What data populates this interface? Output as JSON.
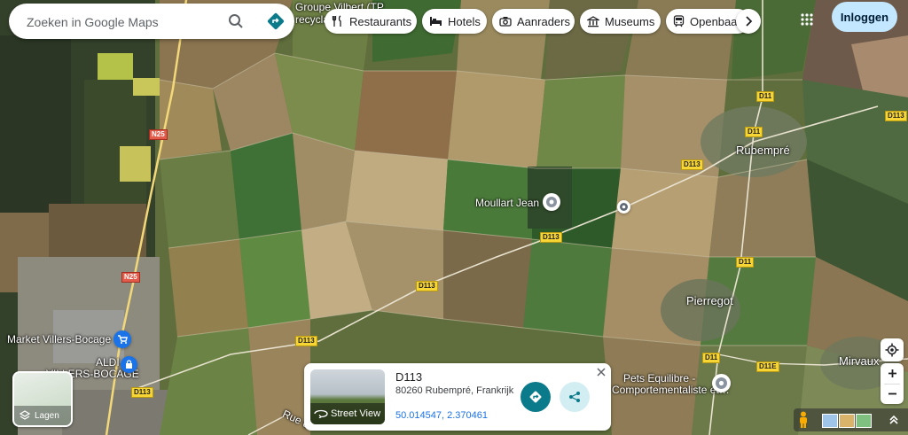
{
  "search": {
    "placeholder": "Zoeken in Google Maps"
  },
  "categories": [
    {
      "label": "Restaurants",
      "icon": "fork-knife-icon"
    },
    {
      "label": "Hotels",
      "icon": "bed-icon"
    },
    {
      "label": "Aanraders",
      "icon": "camera-icon"
    },
    {
      "label": "Museums",
      "icon": "museum-icon"
    },
    {
      "label": "Openbaar",
      "icon": "transit-icon"
    }
  ],
  "header": {
    "signin_label": "Inloggen"
  },
  "places": {
    "groupe": "Groupe Vilbert (TP",
    "recycla": "recycla",
    "rubempre": "Rubempré",
    "moullart": "Moullart Jean",
    "pierregot": "Pierregot",
    "mirvaux": "Mirvaux",
    "market": "Market Villers-Bocage",
    "aldi": "ALDI",
    "villers": "VILLERS-BOCAGE",
    "pets1": "Pets Equilibre -",
    "pets2": "Comportementaliste et…",
    "rue": "Rue d"
  },
  "roads": {
    "d11": "D11",
    "d113": "D113",
    "d11e": "D11E",
    "n25": "N25"
  },
  "card": {
    "title": "D113",
    "address": "80260 Rubempré, Frankrijk",
    "coords": "50.014547, 2.370461",
    "street_view_label": "Street View"
  },
  "layers": {
    "label": "Lagen"
  },
  "colors": {
    "accent": "#1a73e8",
    "teal": "#0b7a8a",
    "signin_bg": "#c2e7ff",
    "road_label": "#f7d535"
  }
}
